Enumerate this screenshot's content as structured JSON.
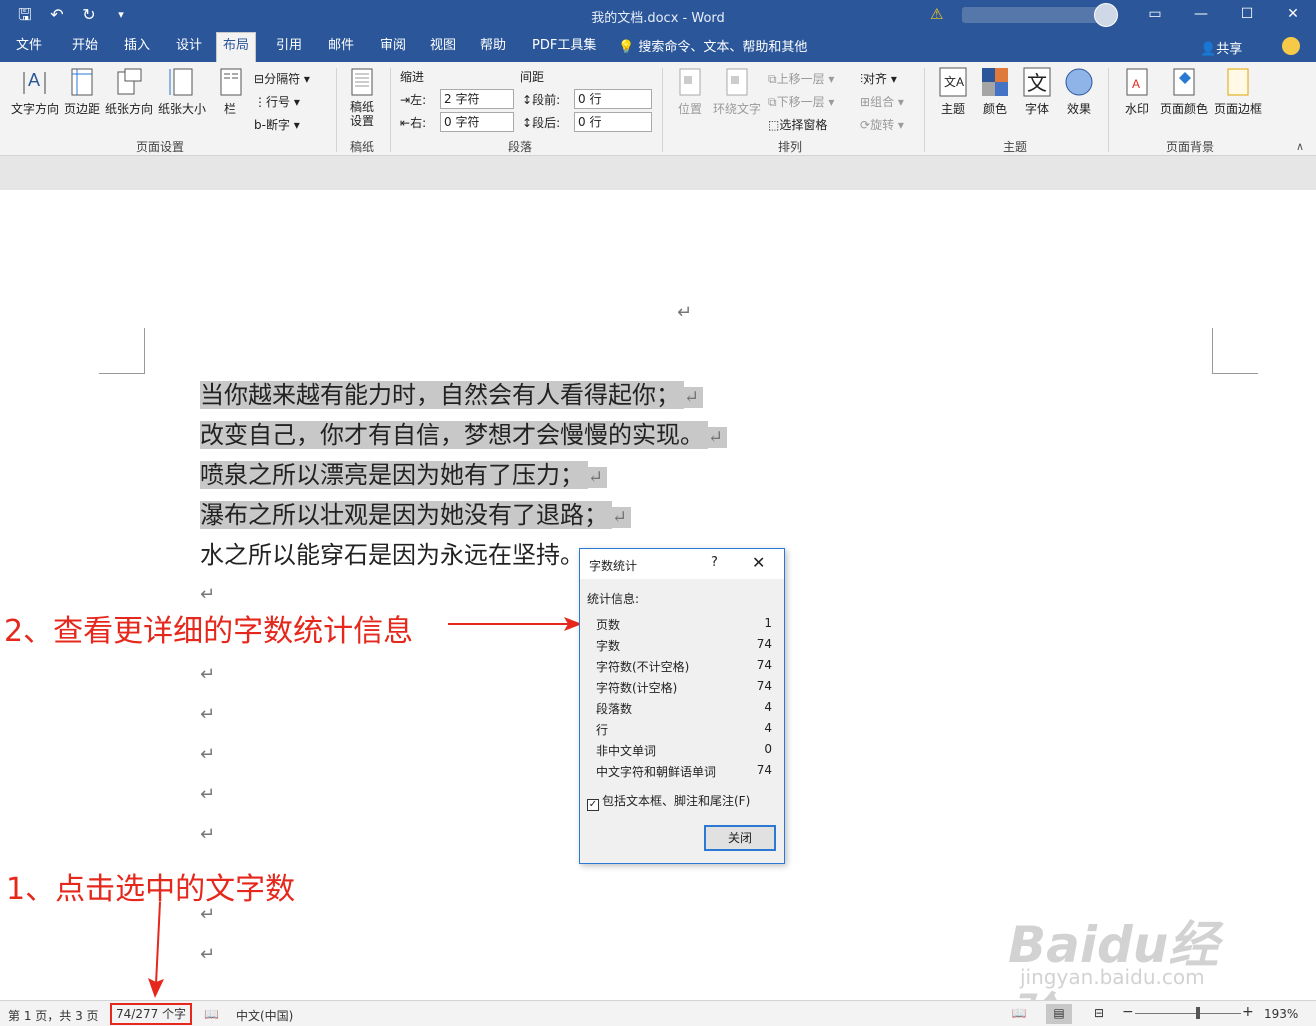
{
  "titlebar": {
    "qat": [
      "save-icon",
      "undo-icon",
      "redo-icon",
      "customize-icon"
    ],
    "doc_title": "我的文档.docx - Word",
    "warning": "⚠",
    "window_buttons": [
      "ribbon-display-icon",
      "minimize-icon",
      "maximize-icon",
      "close-icon"
    ]
  },
  "tabs": [
    {
      "label": "文件"
    },
    {
      "label": "开始"
    },
    {
      "label": "插入"
    },
    {
      "label": "设计"
    },
    {
      "label": "布局",
      "active": true
    },
    {
      "label": "引用"
    },
    {
      "label": "邮件"
    },
    {
      "label": "审阅"
    },
    {
      "label": "视图"
    },
    {
      "label": "帮助"
    },
    {
      "label": "PDF工具集"
    }
  ],
  "tell_me": "搜索命令、文本、帮助和其他",
  "share": "共享",
  "ribbon": {
    "page_setup": {
      "label": "页面设置",
      "text_direction": "文字方向",
      "margins": "页边距",
      "orientation": "纸张方向",
      "size": "纸张大小",
      "columns": "栏",
      "breaks": "分隔符",
      "line_numbers": "行号",
      "hyphenation": "断字"
    },
    "draft": {
      "label": "稿纸",
      "button": "稿纸\n设置"
    },
    "paragraph": {
      "label": "段落",
      "indent_title": "缩进",
      "spacing_title": "间距",
      "left_label": "左:",
      "left_value": "2 字符",
      "right_label": "右:",
      "right_value": "0 字符",
      "before_label": "段前:",
      "before_value": "0 行",
      "after_label": "段后:",
      "after_value": "0 行"
    },
    "arrange": {
      "label": "排列",
      "position": "位置",
      "wrap_text": "环绕文字",
      "bring_forward": "上移一层",
      "send_backward": "下移一层",
      "selection_pane": "选择窗格",
      "align": "对齐",
      "group": "组合",
      "rotate": "旋转"
    },
    "theme": {
      "label": "主题",
      "themes": "主题",
      "colors": "颜色",
      "fonts": "字体",
      "effects": "效果"
    },
    "page_background": {
      "label": "页面背景",
      "watermark": "水印",
      "page_color": "页面颜色",
      "page_borders": "页面边框"
    }
  },
  "document": {
    "lines": [
      {
        "text": "当你越来越有能力时，自然会有人看得起你；",
        "highlight": true
      },
      {
        "text": "改变自己，你才有自信，梦想才会慢慢的实现。",
        "highlight": true
      },
      {
        "text": "喷泉之所以漂亮是因为她有了压力；",
        "highlight": true
      },
      {
        "text": "瀑布之所以壮观是因为她没有了退路；",
        "highlight": true
      },
      {
        "text": "水之所以能穿石是因为永远在坚持。",
        "highlight": false
      }
    ],
    "paragraph_mark": "↵"
  },
  "annotations": {
    "step1": "1、点击选中的文字数",
    "step2": "2、查看更详细的字数统计信息"
  },
  "dialog": {
    "title": "字数统计",
    "help": "?",
    "close": "✕",
    "section": "统计信息:",
    "stats": [
      {
        "label": "页数",
        "value": "1"
      },
      {
        "label": "字数",
        "value": "74"
      },
      {
        "label": "字符数(不计空格)",
        "value": "74"
      },
      {
        "label": "字符数(计空格)",
        "value": "74"
      },
      {
        "label": "段落数",
        "value": "4"
      },
      {
        "label": "行",
        "value": "4"
      },
      {
        "label": "非中文单词",
        "value": "0"
      },
      {
        "label": "中文字符和朝鲜语单词",
        "value": "74"
      }
    ],
    "checkbox_label": "包括文本框、脚注和尾注(F)",
    "checkbox_checked": true,
    "close_button": "关闭"
  },
  "statusbar": {
    "page": "第 1 页，共 3 页",
    "word_count": "74/277 个字",
    "language": "中文(中国)",
    "zoom": "193%"
  },
  "watermark": {
    "brand": "Baidu经验",
    "url": "jingyan.baidu.com"
  },
  "colors": {
    "accent": "#2b579a",
    "annotation_red": "#e5271c",
    "highlight": "#c8c8c8"
  }
}
